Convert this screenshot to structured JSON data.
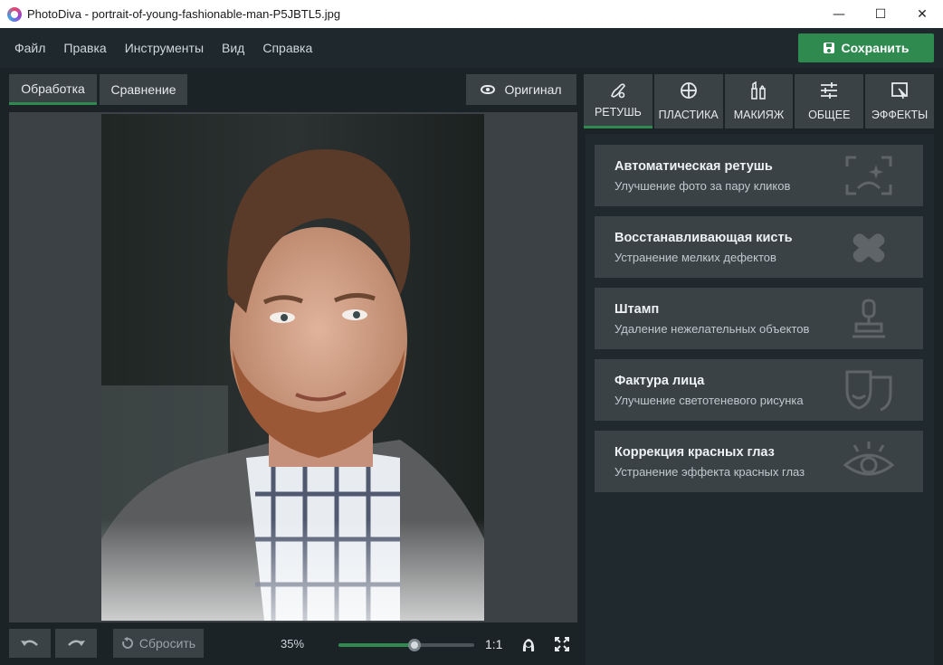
{
  "window": {
    "title": "PhotoDiva - portrait-of-young-fashionable-man-P5JBTL5.jpg",
    "minimize_glyph": "—",
    "maximize_glyph": "☐",
    "close_glyph": "✕"
  },
  "menu": {
    "items": [
      "Файл",
      "Правка",
      "Инструменты",
      "Вид",
      "Справка"
    ],
    "save_label": "Сохранить"
  },
  "view": {
    "tab_process": "Обработка",
    "tab_compare": "Сравнение",
    "original_label": "Оригинал"
  },
  "bottom": {
    "reset_label": "Сбросить",
    "zoom_label": "35%",
    "zoom_level": 0.56,
    "ratio_label": "1:1"
  },
  "tool_tabs": [
    {
      "label": "РЕТУШЬ",
      "icon": "retouch-brush-icon",
      "active": true
    },
    {
      "label": "ПЛАСТИКА",
      "icon": "plastic-circle-icon",
      "active": false
    },
    {
      "label": "МАКИЯЖ",
      "icon": "makeup-icon",
      "active": false
    },
    {
      "label": "ОБЩЕЕ",
      "icon": "sliders-icon",
      "active": false
    },
    {
      "label": "ЭФФЕКТЫ",
      "icon": "effects-icon",
      "active": false
    }
  ],
  "tools": [
    {
      "title": "Автоматическая ретушь",
      "subtitle": "Улучшение фото за пару кликов",
      "icon": "auto-retouch-icon"
    },
    {
      "title": "Восстанавливающая кисть",
      "subtitle": "Устранение мелких дефектов",
      "icon": "bandage-icon"
    },
    {
      "title": "Штамп",
      "subtitle": "Удаление нежелательных объектов",
      "icon": "stamp-icon"
    },
    {
      "title": "Фактура лица",
      "subtitle": "Улучшение светотеневого рисунка",
      "icon": "masks-icon"
    },
    {
      "title": "Коррекция красных глаз",
      "subtitle": "Устранение эффекта красных глаз",
      "icon": "eye-icon"
    }
  ],
  "colors": {
    "accent": "#2e8a4f",
    "panel": "#3a4246",
    "background": "#1b2327"
  }
}
